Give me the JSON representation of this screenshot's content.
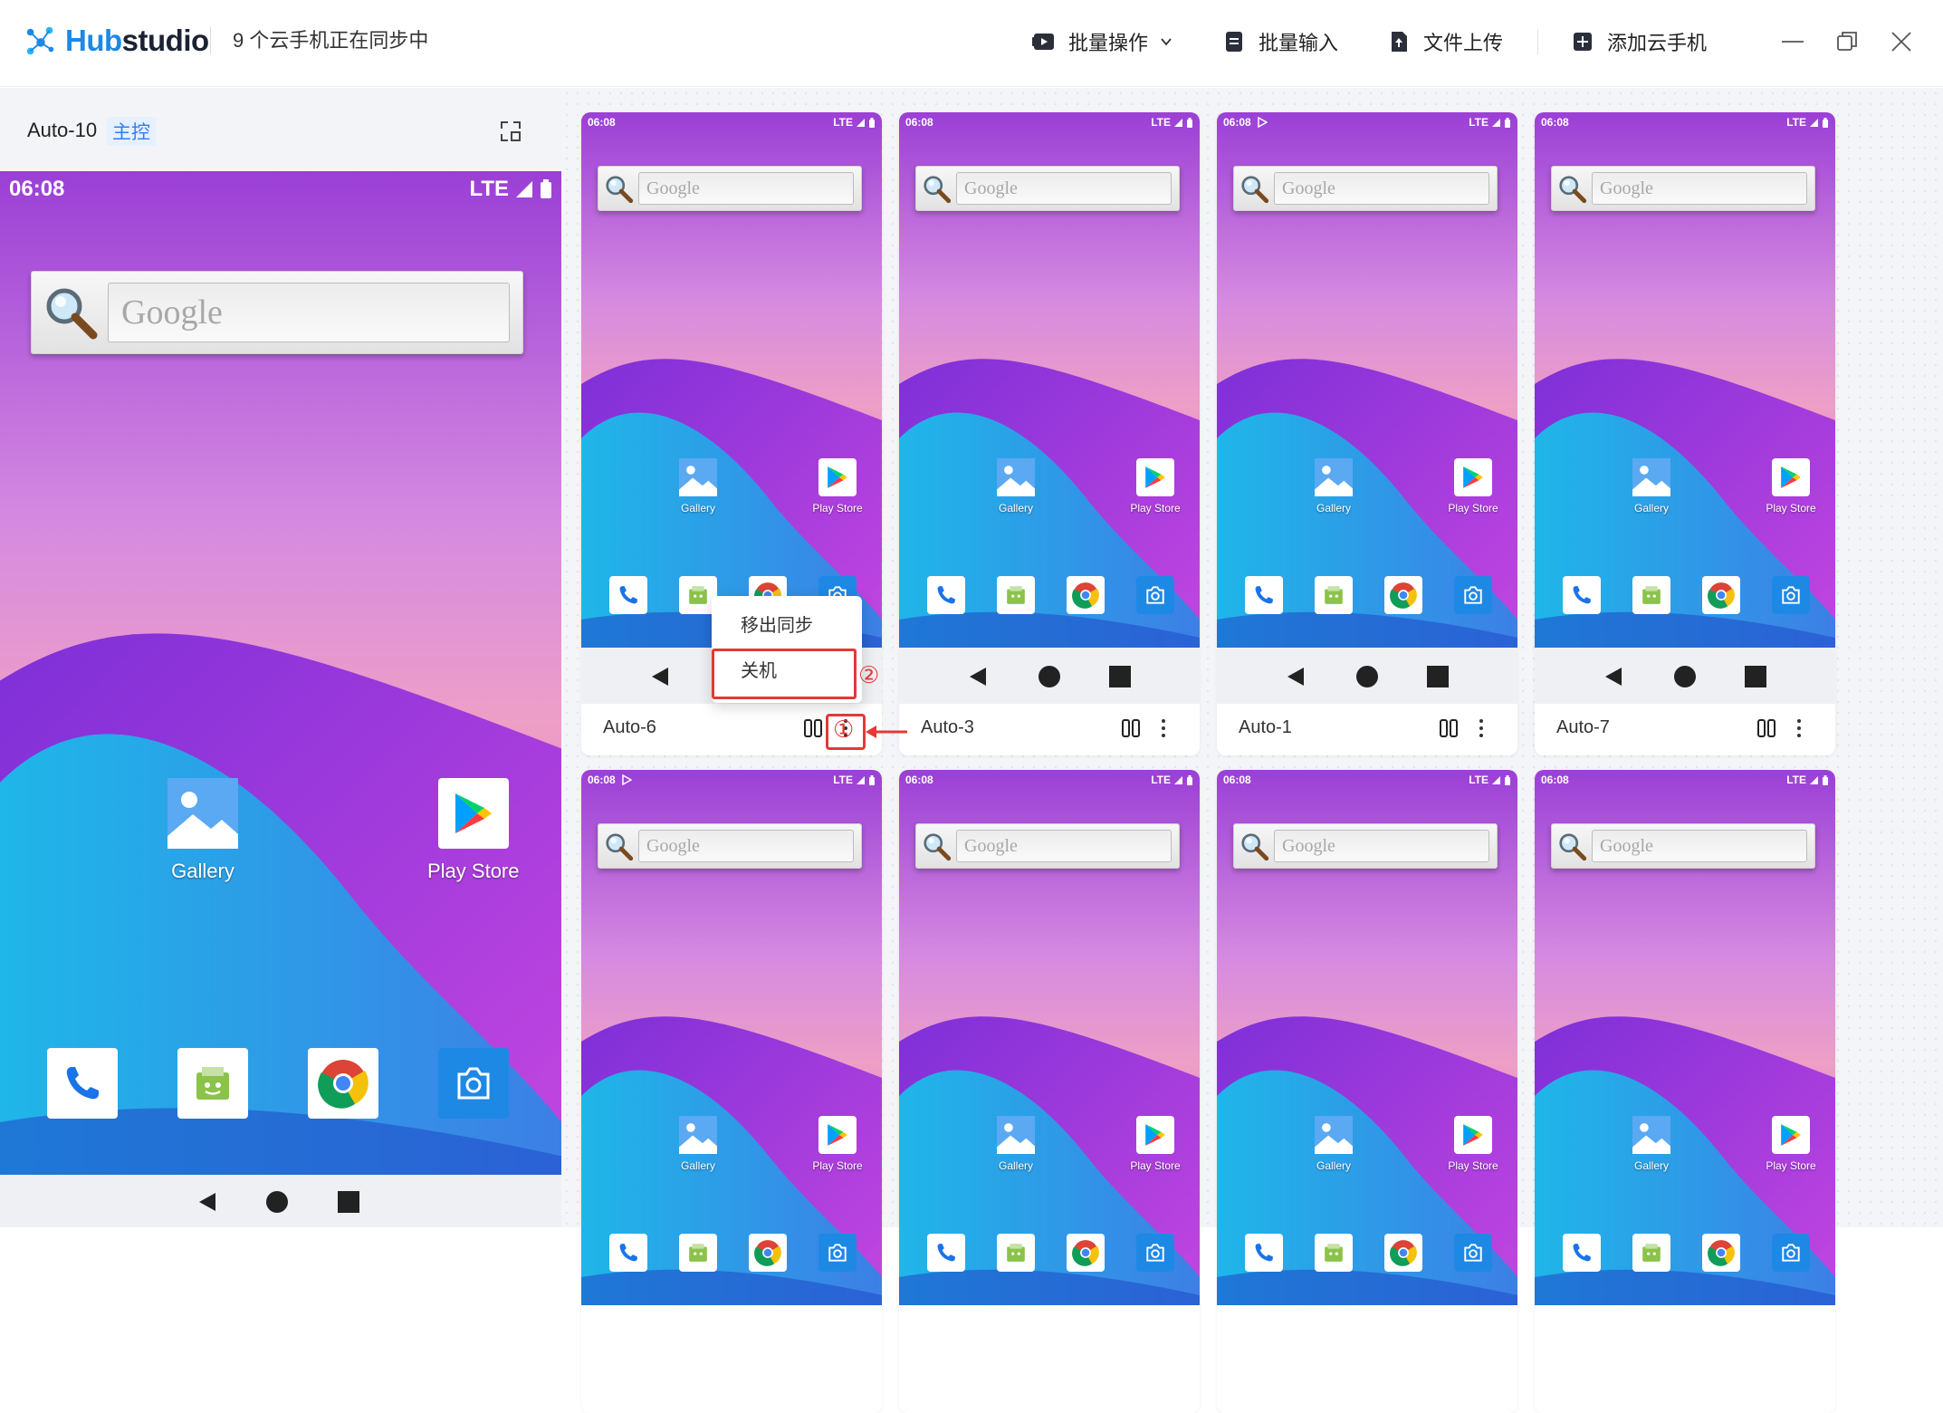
{
  "app": {
    "logo_hub": "Hub",
    "logo_studio": "studio",
    "sync_status": "9 个云手机正在同步中"
  },
  "toolbar": {
    "batch_ops": "批量操作",
    "batch_input": "批量输入",
    "file_upload": "文件上传",
    "add_phone": "添加云手机"
  },
  "master": {
    "name": "Auto-10",
    "tag": "主控"
  },
  "phone": {
    "time": "06:08",
    "network": "LTE",
    "search_placeholder": "Google",
    "apps": {
      "gallery": "Gallery",
      "play_store": "Play Store"
    }
  },
  "cards": [
    {
      "name": "Auto-6"
    },
    {
      "name": "Auto-3"
    },
    {
      "name": "Auto-1"
    },
    {
      "name": "Auto-7"
    },
    {
      "name": ""
    },
    {
      "name": ""
    },
    {
      "name": ""
    },
    {
      "name": ""
    }
  ],
  "context_menu": {
    "items": [
      "移出同步",
      "关机"
    ]
  },
  "annotations": {
    "step1": "①",
    "step2": "②"
  },
  "colors": {
    "brand_blue": "#1e88e5",
    "accent_blue": "#2d7ff9",
    "annotation_red": "#e53935"
  }
}
